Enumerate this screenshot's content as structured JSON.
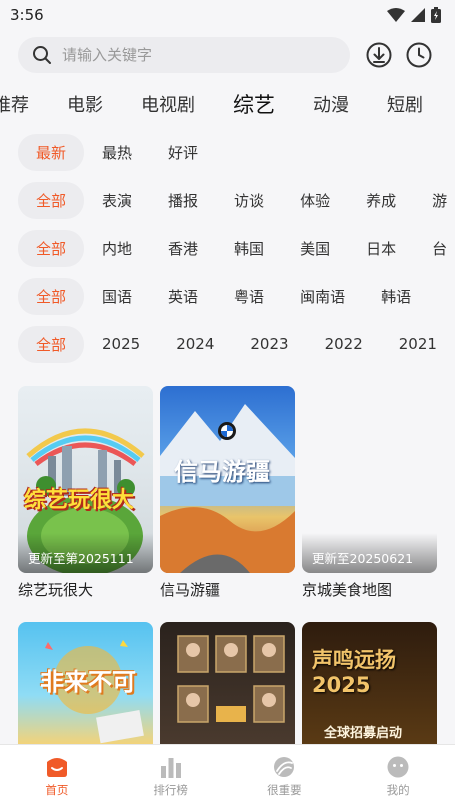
{
  "status": {
    "time": "3:56"
  },
  "search": {
    "placeholder": "请输入关键字"
  },
  "tabs": [
    "推荐",
    "电影",
    "电视剧",
    "综艺",
    "动漫",
    "短剧"
  ],
  "active_tab": "综艺",
  "filters": {
    "sort": [
      "最新",
      "最热",
      "好评"
    ],
    "genre": [
      "全部",
      "表演",
      "播报",
      "访谈",
      "体验",
      "养成",
      "游"
    ],
    "region": [
      "全部",
      "内地",
      "香港",
      "韩国",
      "美国",
      "日本",
      "台"
    ],
    "language": [
      "全部",
      "国语",
      "英语",
      "粤语",
      "闽南语",
      "韩语"
    ],
    "year": [
      "全部",
      "2025",
      "2024",
      "2023",
      "2022",
      "2021"
    ]
  },
  "cards": [
    {
      "title": "综艺玩很大",
      "update": "更新至第2025111",
      "poster_text": "综艺玩很大"
    },
    {
      "title": "信马游疆",
      "update": "",
      "poster_text": "信马游疆"
    },
    {
      "title": "京城美食地图",
      "update": "更新至20250621",
      "poster_text": ""
    },
    {
      "title": "",
      "update": "",
      "poster_text": "非来不可"
    },
    {
      "title": "",
      "update": "",
      "poster_text": ""
    },
    {
      "title": "",
      "update": "",
      "poster_text": "声鸣远扬 2025",
      "poster_sub": "全球招募启动"
    }
  ],
  "bottom_nav": [
    {
      "label": "首页",
      "icon": "home-icon",
      "active": true
    },
    {
      "label": "排行榜",
      "icon": "ranking-icon"
    },
    {
      "label": "很重要",
      "icon": "important-icon"
    },
    {
      "label": "我的",
      "icon": "profile-icon"
    }
  ],
  "colors": {
    "accent": "#f05a28"
  }
}
